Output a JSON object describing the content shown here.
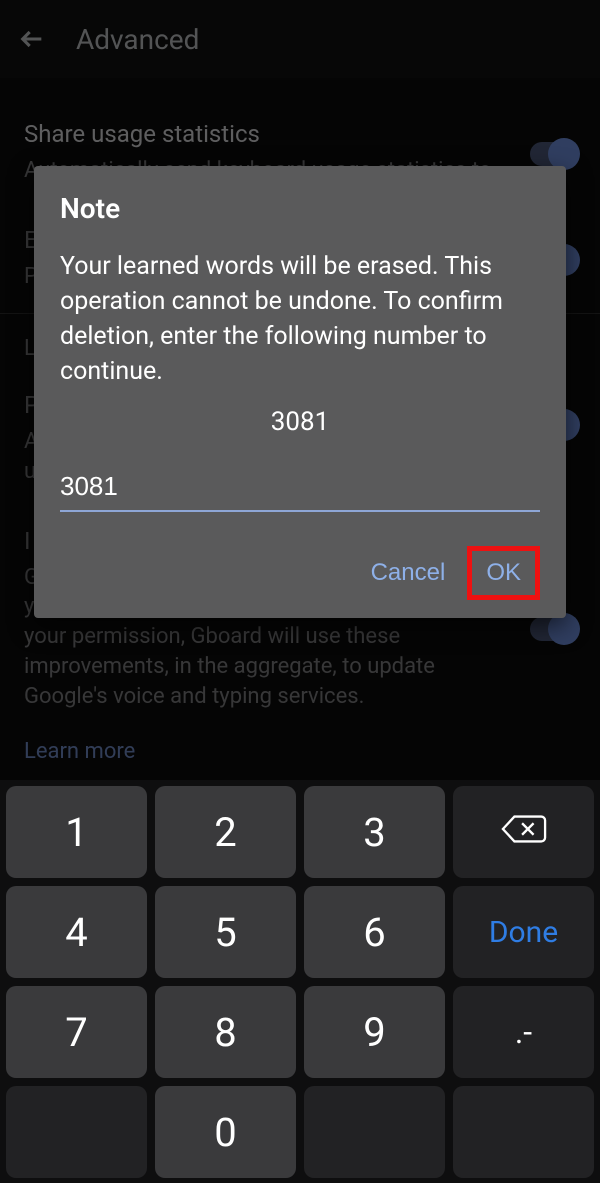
{
  "header": {
    "title": "Advanced"
  },
  "settings": {
    "share": {
      "title": "Share usage statistics",
      "sub": "Automatically send keyboard usage statistics to"
    },
    "row2": {
      "title": "E",
      "sub": "P"
    },
    "link1": "L",
    "row3": {
      "title": "P",
      "sub": "A\nu"
    },
    "improve": {
      "title_prefix": "I",
      "sub_prefix": "G",
      "sub_rest": "your device based on your usage patterns. With your permission, Gboard will use these improvements, in the aggregate, to update Google's voice and typing services."
    },
    "learn_more": "Learn more"
  },
  "dialog": {
    "title": "Note",
    "body": "Your learned words will be erased. This operation cannot be undone. To confirm deletion, enter the following number to continue.",
    "code": "3081",
    "input_value": "3081",
    "cancel": "Cancel",
    "ok": "OK"
  },
  "keyboard": {
    "rows": [
      [
        "1",
        "2",
        "3",
        "backspace"
      ],
      [
        "4",
        "5",
        "6",
        "Done"
      ],
      [
        "7",
        "8",
        "9",
        ".-"
      ],
      [
        "",
        "0",
        "",
        ""
      ]
    ],
    "done_label": "Done",
    "dotdash": ".-"
  }
}
